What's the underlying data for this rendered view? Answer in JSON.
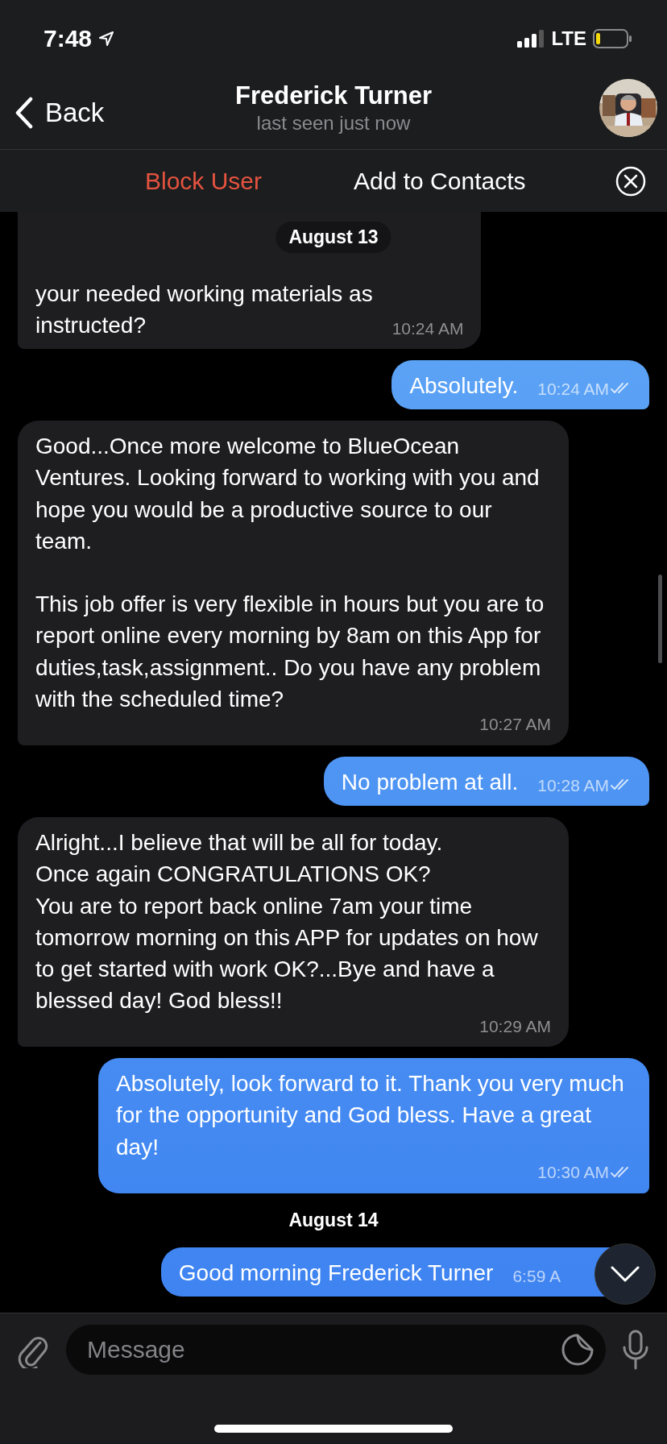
{
  "status_bar": {
    "time": "7:48",
    "network": "LTE"
  },
  "header": {
    "back": "Back",
    "title": "Frederick Turner",
    "subtitle": "last seen just now"
  },
  "action_bar": {
    "block": "Block User",
    "add": "Add to Contacts"
  },
  "floating_date": "August 13",
  "messages": [
    {
      "kind": "in",
      "text": "your needed working materials as\ninstructed?",
      "time": "10:24 AM",
      "cut": true
    },
    {
      "kind": "out",
      "text": "Absolutely.",
      "time": "10:24 AM",
      "read": true
    },
    {
      "kind": "in",
      "text": "Good...Once more welcome to BlueOcean Ventures. Looking forward to working with you and hope you would be a productive source to our team.\n\nThis job offer is very flexible in hours but you are to report online every morning by 8am on this App for duties,task,assignment.. Do you have any problem with the scheduled time?",
      "time": "10:27 AM"
    },
    {
      "kind": "out",
      "text": "No problem at all.",
      "time": "10:28 AM",
      "read": true
    },
    {
      "kind": "in",
      "text": "Alright...I believe that will be all for today.\nOnce again CONGRATULATIONS OK?\nYou are to report back online 7am your time tomorrow morning on this APP for updates on how to get started with work OK?...Bye and have a blessed day! God bless!!",
      "time": "10:29 AM"
    },
    {
      "kind": "out",
      "text": "Absolutely, look forward to it. Thank you very much for the opportunity and God bless. Have a great day!",
      "time": "10:30 AM",
      "read": true
    },
    {
      "kind": "date",
      "text": "August 14"
    },
    {
      "kind": "out",
      "text": "Good morning Frederick Turner",
      "time": "6:59 A"
    }
  ],
  "input": {
    "placeholder": "Message"
  }
}
